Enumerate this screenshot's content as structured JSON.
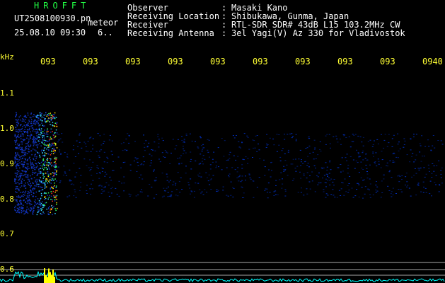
{
  "app": {
    "logo": "HROFFT",
    "file_name": "UT2508100930.pn",
    "file_tag": "meteor",
    "date_time": "25.08.10 09:30",
    "count": "6.."
  },
  "header": {
    "rows": [
      {
        "label": "Observer",
        "sep": ":",
        "value": "Masaki Kano"
      },
      {
        "label": "Receiving Location",
        "sep": ":",
        "value": "Shibukawa, Gunma, Japan"
      },
      {
        "label": "Receiver",
        "sep": ":",
        "value": "RTL-SDR SDR# 43dB L15 103.2MHz CW"
      },
      {
        "label": "Receiving Antenna",
        "sep": ":",
        "value": "3el Yagi(V) Az 330 for Vladivostok"
      }
    ]
  },
  "x_axis": {
    "ticks": [
      "093",
      "093",
      "093",
      "093",
      "093",
      "093",
      "093",
      "093",
      "093",
      "0940"
    ]
  },
  "y_axis": {
    "unit": "kHz",
    "ticks": [
      "1.1",
      "1.0",
      "0.9",
      "0.8",
      "0.7",
      "0.6"
    ]
  },
  "colors": {
    "text": "#ffffff",
    "axis": "#ffff33",
    "logo": "#22ff44",
    "background": "#000000",
    "spectrum": "#00ffff",
    "meteor_peak": "#ffff00"
  }
}
